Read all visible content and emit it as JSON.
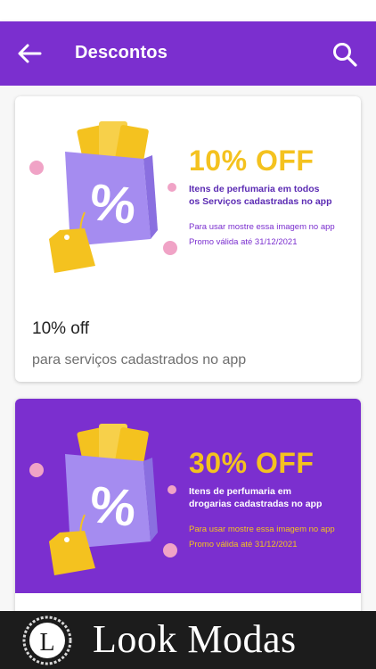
{
  "appbar": {
    "title": "Descontos",
    "back_icon": "arrow-left-icon",
    "search_icon": "search-icon",
    "background": "#7b2fcf"
  },
  "coupons": [
    {
      "big": "10% OFF",
      "desc_line1": "Itens de perfumaria em todos",
      "desc_line2": "os Serviços cadastradas no app",
      "usage": "Para usar mostre essa imagem no app",
      "valid": "Promo válida até 31/12/2021",
      "title": "10% off",
      "subtitle": "para serviços cadastrados no app",
      "banner_background": "#ffffff"
    },
    {
      "big": "30% OFF",
      "desc_line1": "Itens de perfumaria em",
      "desc_line2": "drogarias cadastradas no app",
      "usage": "Para usar mostre essa imagem no app",
      "valid": "Promo válida até 31/12/2021",
      "banner_background": "#7b2fcf"
    }
  ],
  "ad_banner": {
    "logo_letter": "L",
    "brand": "Look Modas"
  },
  "colors": {
    "accent": "#7b2fcf",
    "yellow": "#f4c21f",
    "pink": "#f0a3c6"
  }
}
